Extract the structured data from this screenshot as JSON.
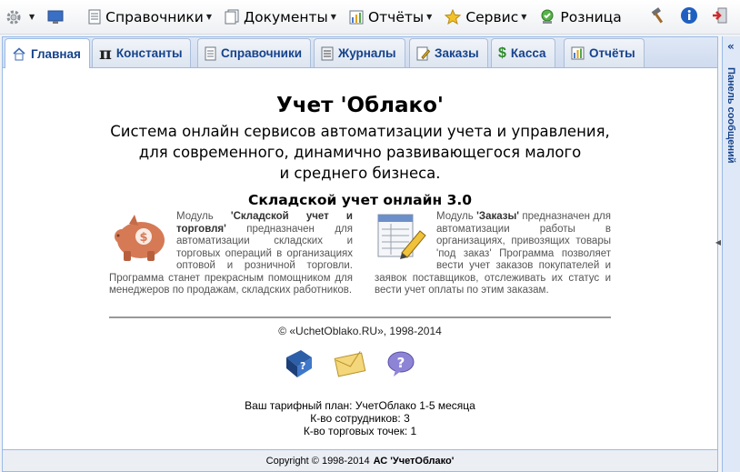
{
  "menubar": {
    "items": [
      {
        "label": "Справочники",
        "icon": "directory-icon"
      },
      {
        "label": "Документы",
        "icon": "documents-icon"
      },
      {
        "label": "Отчёты",
        "icon": "reports-icon"
      },
      {
        "label": "Сервис",
        "icon": "star-icon"
      },
      {
        "label": "Розница",
        "icon": "retail-icon"
      }
    ]
  },
  "tabs": [
    {
      "label": "Главная",
      "icon": "home-icon",
      "active": true
    },
    {
      "label": "Константы",
      "icon": "pi-icon"
    },
    {
      "label": "Справочники",
      "icon": "directory-icon"
    },
    {
      "label": "Журналы",
      "icon": "journal-icon"
    },
    {
      "label": "Заказы",
      "icon": "orders-icon"
    },
    {
      "label": "Касса",
      "icon": "dollar-icon"
    },
    {
      "label": "Отчёты",
      "icon": "chart-icon"
    }
  ],
  "side_panel": {
    "label": "Панель сообщений"
  },
  "content": {
    "title": "Учет 'Облако'",
    "subtitle_lines": [
      "Система онлайн сервисов автоматизации учета и управления,",
      "для современного, динамично развивающегося малого",
      "и среднего бизнеса."
    ],
    "heading": "Складской учет онлайн 3.0",
    "module_left": {
      "prefix": "Модуль ",
      "name": "'Складской учет и торговля'",
      "text": " предназначен для автоматизации складских и торговых операций в организациях оптовой и розничной торговли. Программа станет прекрасным помощником для менеджеров по продажам, складских работников."
    },
    "module_right": {
      "prefix": "Модуль ",
      "name": "'Заказы'",
      "text": " предназначен для автоматизации работы в организациях, привозящих товары 'под заказ' Программа позволяет вести учет заказов покупателей и заявок поставщиков, отслеживать их статус и вести учет оплаты по этим заказам."
    },
    "copyright": "© «UchetOblako.RU», 1998-2014",
    "tariff_lines": [
      "Ваш тарифный план: УчетОблако 1-5 месяца",
      "К-во сотрудников: 3",
      "К-во торговых точек: 1"
    ]
  },
  "footer": {
    "text": "Copyright © 1998-2014",
    "brand": "АС 'УчетОблако'"
  },
  "colors": {
    "tab_text": "#15428b",
    "border": "#99bbe8"
  }
}
